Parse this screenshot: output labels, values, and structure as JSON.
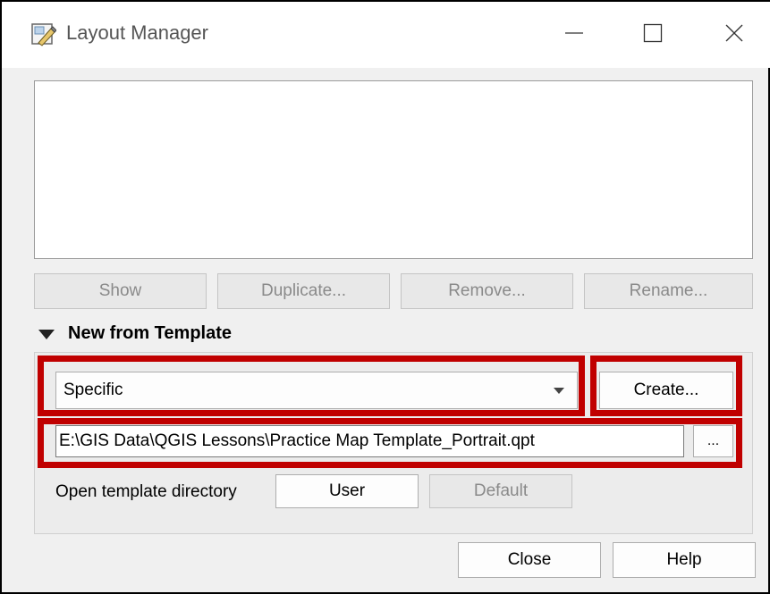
{
  "window": {
    "title": "Layout Manager",
    "icon": "layout-manager-icon"
  },
  "layouts_list": {
    "items": []
  },
  "buttons": {
    "show": "Show",
    "duplicate": "Duplicate...",
    "remove": "Remove...",
    "rename": "Rename..."
  },
  "new_from_template": {
    "title": "New from Template",
    "template_type": "Specific",
    "create_label": "Create...",
    "template_path": "E:\\GIS Data\\QGIS Lessons\\Practice Map Template_Portrait.qpt",
    "browse_label": "...",
    "open_dir_label": "Open template directory",
    "user_label": "User",
    "default_label": "Default"
  },
  "footer": {
    "close_label": "Close",
    "help_label": "Help"
  },
  "colors": {
    "highlight": "#c00000",
    "dialog_bg": "#f0f0f0"
  }
}
